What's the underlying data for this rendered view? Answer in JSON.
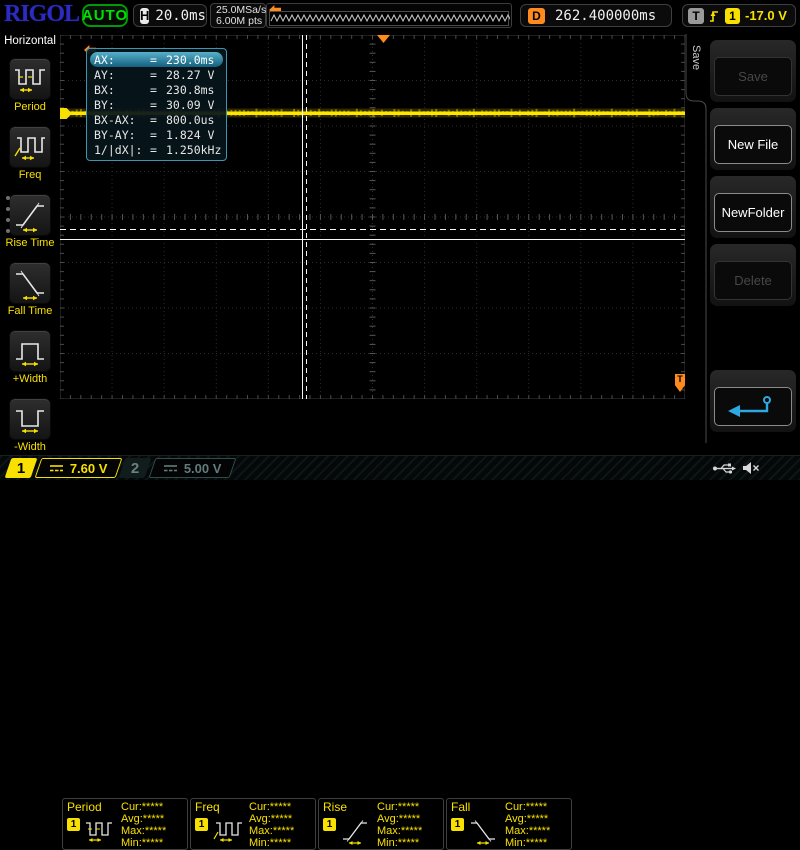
{
  "top_bar": {
    "logo": "RIGOL",
    "run_status": "AUTO",
    "horizontal_label": "H",
    "timebase": "20.0ms",
    "sample_rate": "25.0MSa/s",
    "memory_depth": "6.00M pts",
    "delay_label": "D",
    "delay_value": "262.400000ms",
    "trigger_label": "T",
    "trigger_source": "1",
    "trigger_level": "-17.0 V"
  },
  "left_menu": {
    "title": "Horizontal",
    "items": [
      {
        "label": "Period",
        "icon": "period-icon"
      },
      {
        "label": "Freq",
        "icon": "freq-icon"
      },
      {
        "label": "Rise Time",
        "icon": "rise-time-icon"
      },
      {
        "label": "Fall Time",
        "icon": "fall-time-icon"
      },
      {
        "label": "+Width",
        "icon": "plus-width-icon"
      },
      {
        "label": "-Width",
        "icon": "minus-width-icon"
      }
    ]
  },
  "cursor_readout": {
    "eq": "=",
    "rows": [
      {
        "label": "AX:",
        "value": "230.0ms"
      },
      {
        "label": "AY:",
        "value": "28.27 V"
      },
      {
        "label": "BX:",
        "value": "230.8ms"
      },
      {
        "label": "BY:",
        "value": "30.09 V"
      },
      {
        "label": "BX-AX:",
        "value": "800.0us"
      },
      {
        "label": "BY-AY:",
        "value": "1.824 V"
      },
      {
        "label": "1/|dX|:",
        "value": "1.250kHz"
      }
    ]
  },
  "right_menu": {
    "tab_label": "Save",
    "buttons": [
      {
        "label": "Save",
        "enabled": false
      },
      {
        "label": "New File",
        "enabled": true
      },
      {
        "label": "NewFolder",
        "enabled": true
      },
      {
        "label": "Delete",
        "enabled": false
      }
    ],
    "return_button_icon": "return-arrow-icon"
  },
  "measurements": [
    {
      "title": "Period",
      "channel": "1",
      "lines": [
        "Cur:*****",
        "Avg:*****",
        "Max:*****",
        "Min:*****"
      ]
    },
    {
      "title": "Freq",
      "channel": "1",
      "lines": [
        "Cur:*****",
        "Avg:*****",
        "Max:*****",
        "Min:*****"
      ]
    },
    {
      "title": "Rise",
      "channel": "1",
      "lines": [
        "Cur:*****",
        "Avg:*****",
        "Max:*****",
        "Min:*****"
      ]
    },
    {
      "title": "Fall",
      "channel": "1",
      "lines": [
        "Cur:*****",
        "Avg:*****",
        "Max:*****",
        "Min:*****"
      ]
    }
  ],
  "status_bar": {
    "channel1": {
      "number": "1",
      "scale": "7.60 V"
    },
    "channel2": {
      "number": "2",
      "scale": "5.00 V"
    }
  },
  "markers": {
    "trigger_level_tag": "T"
  },
  "colors": {
    "channel1_yellow": "#F8E000",
    "trigger_orange": "#FF8A1E",
    "auto_green": "#00E000",
    "logo_blue": "#2B2BC0",
    "cursor_box_teal": "#3E96AE",
    "return_arrow_blue": "#2FA8E1"
  }
}
